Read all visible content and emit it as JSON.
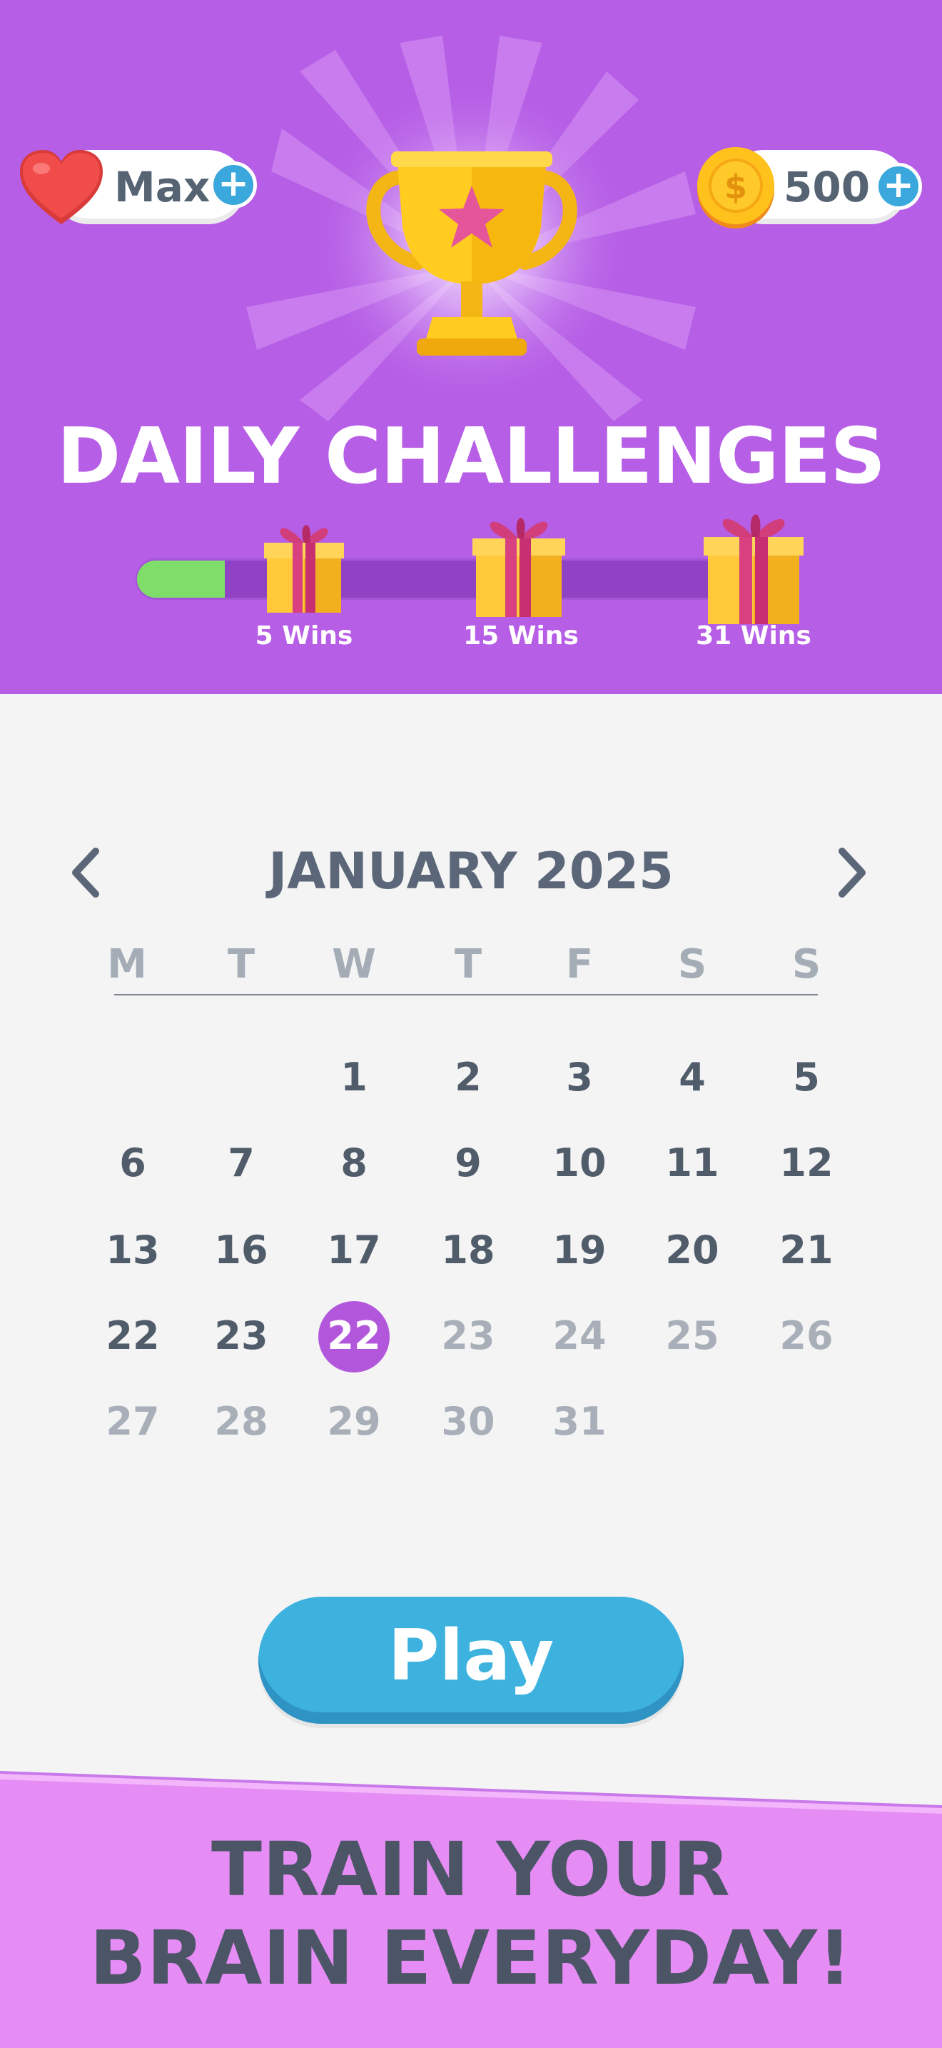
{
  "header": {
    "lives_label": "Max",
    "coins_value": "500",
    "title": "DAILY CHALLENGES",
    "progress": 0.14,
    "milestones": [
      {
        "label": "5 Wins"
      },
      {
        "label": "15 Wins"
      },
      {
        "label": "31 Wins"
      }
    ],
    "plus_symbol": "+"
  },
  "calendar": {
    "month_title": "JANUARY 2025",
    "weekdays": [
      "M",
      "T",
      "W",
      "T",
      "F",
      "S",
      "S"
    ],
    "rows": [
      [
        "",
        "",
        "1",
        "2",
        "3",
        "4",
        "5"
      ],
      [
        "6",
        "7",
        "8",
        "9",
        "10",
        "11",
        "12"
      ],
      [
        "13",
        "16",
        "17",
        "18",
        "19",
        "20",
        "21"
      ],
      [
        "22",
        "23",
        "22",
        "23",
        "24",
        "25",
        "26"
      ],
      [
        "27",
        "28",
        "29",
        "30",
        "31",
        "",
        ""
      ]
    ]
  },
  "play_label": "Play",
  "footer": {
    "line1": "TRAIN YOUR",
    "line2": "BRAIN EVERYDAY!"
  },
  "colors": {
    "header_bg": "#b65ee6",
    "accent_purple": "#b257dc",
    "play_blue": "#3db2df",
    "progress_green": "#7fde6a",
    "footer_pink": "#e58cf5",
    "text_dark": "#515c6b",
    "text_muted": "#a8afb8"
  },
  "icons": [
    "heart-icon",
    "coin-icon",
    "plus-icon",
    "trophy-icon",
    "gift-icon",
    "chevron-left-icon",
    "chevron-right-icon"
  ]
}
